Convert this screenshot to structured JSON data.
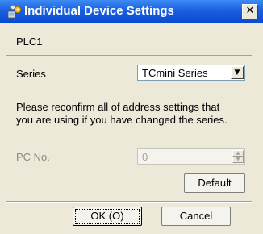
{
  "window": {
    "title": "Individual Device Settings",
    "close_glyph": "✕",
    "icon": "device-settings-icon"
  },
  "device": {
    "name": "PLC1"
  },
  "series": {
    "label": "Series",
    "value": "TCmini Series",
    "arrow_glyph": "▼"
  },
  "notice": {
    "line1": "Please reconfirm all of address settings that",
    "line2": "you are using if you have changed the series."
  },
  "pc_no": {
    "label": "PC No.",
    "value": "0",
    "up_glyph": "▲",
    "down_glyph": "▼"
  },
  "buttons": {
    "default_label": "Default",
    "ok_label": "OK (O)",
    "cancel_label": "Cancel"
  },
  "colors": {
    "titlebar": "#0A49D0",
    "dialog_bg": "#ECE9D8"
  }
}
